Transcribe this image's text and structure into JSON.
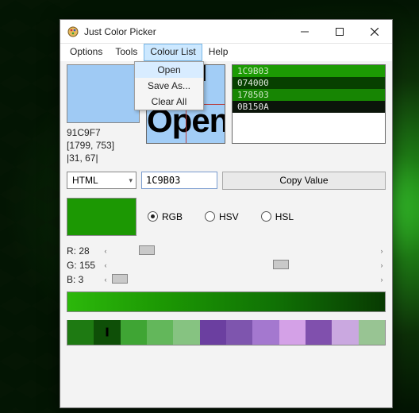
{
  "window": {
    "title": "Just Color Picker"
  },
  "menu": {
    "options": "Options",
    "tools": "Tools",
    "colour_list": "Colour List",
    "help": "Help",
    "dropdown": {
      "open": "Open",
      "save_as": "Save As...",
      "clear_all": "Clear All"
    }
  },
  "info": {
    "hex": "91C9F7",
    "coords": "[1799, 753]",
    "offset": "|31, 67|"
  },
  "preview": {
    "text1": "»l",
    "text2": "Open"
  },
  "history": [
    {
      "code": "1C9B03",
      "bg": "#1c9b03",
      "fg": "#cfe9c6"
    },
    {
      "code": "074000",
      "bg": "#074000",
      "fg": "#dfe7dc"
    },
    {
      "code": "178503",
      "bg": "#178503",
      "fg": "#cfe7c6"
    },
    {
      "code": "0B150A",
      "bg": "#0b150a",
      "fg": "#e6e6e6"
    }
  ],
  "format": {
    "selected": "HTML",
    "value": "1C9B03",
    "copy_label": "Copy Value"
  },
  "model_radios": {
    "rgb": "RGB",
    "hsv": "HSV",
    "hsl": "HSL",
    "selected": "rgb"
  },
  "sliders": {
    "r": {
      "label": "R: 28",
      "pos_pct": 11
    },
    "g": {
      "label": "G: 155",
      "pos_pct": 61
    },
    "b": {
      "label": "B: 3",
      "pos_pct": 1
    }
  },
  "current_color": "#1c9803",
  "palette": [
    "#1e7a12",
    "#0e4f07",
    "#3fa534",
    "#63b75b",
    "#86c381",
    "#6b3fa0",
    "#7e55ae",
    "#a478cf",
    "#d4a1e7",
    "#8050ad",
    "#caa8e0",
    "#98c493"
  ],
  "palette_selected_index": 1
}
